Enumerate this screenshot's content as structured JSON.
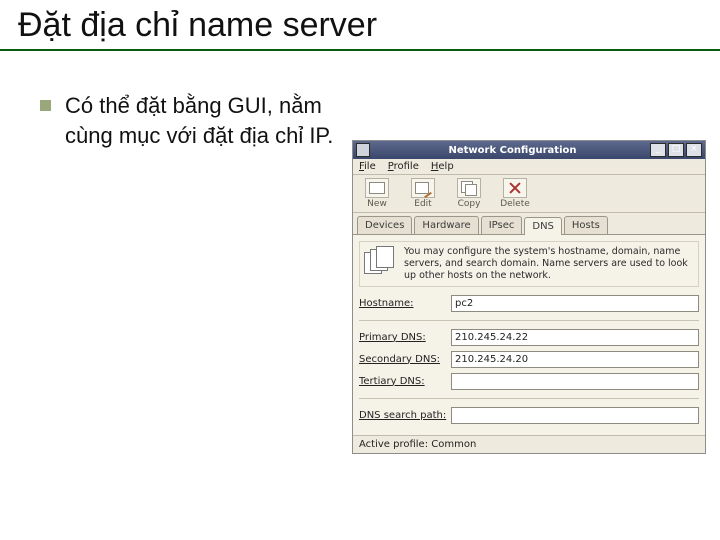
{
  "slide": {
    "title": "Đặt địa chỉ name server",
    "bullet": "Có thể đặt bằng GUI, nằm cùng mục với đặt địa chỉ IP."
  },
  "window": {
    "title": "Network Configuration",
    "min": "_",
    "max": "□",
    "close": "×",
    "menu": {
      "file": "File",
      "profile": "Profile",
      "help": "Help"
    },
    "toolbar": {
      "new": "New",
      "edit": "Edit",
      "copy": "Copy",
      "delete": "Delete"
    },
    "tabs": {
      "devices": "Devices",
      "hardware": "Hardware",
      "ipsec": "IPsec",
      "dns": "DNS",
      "hosts": "Hosts"
    },
    "info": "You may configure the system's hostname, domain, name servers, and search domain. Name servers are used to look up other hosts on the network.",
    "fields": {
      "hostname_label": "Hostname:",
      "hostname_value": "pc2",
      "primary_label": "Primary DNS:",
      "primary_value": "210.245.24.22",
      "secondary_label": "Secondary DNS:",
      "secondary_value": "210.245.24.20",
      "tertiary_label": "Tertiary DNS:",
      "tertiary_value": "",
      "search_label": "DNS search path:",
      "search_value": ""
    },
    "status": "Active profile: Common"
  }
}
